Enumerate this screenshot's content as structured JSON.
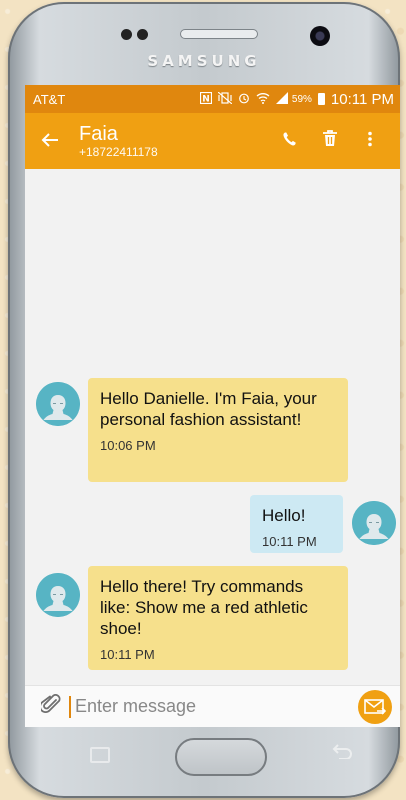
{
  "device": {
    "brand": "SAMSUNG"
  },
  "status_bar": {
    "carrier": "AT&T",
    "battery_percent": "59%",
    "time": "10:11 PM"
  },
  "app_bar": {
    "contact_name": "Faia",
    "contact_number": "+18722411178",
    "icons": [
      "back-arrow-icon",
      "phone-icon",
      "trash-icon",
      "more-vert-icon"
    ]
  },
  "messages": [
    {
      "direction": "incoming",
      "text": "Hello Danielle. I'm Faia, your personal fashion assistant!",
      "time": "10:06 PM"
    },
    {
      "direction": "outgoing",
      "text": "Hello!",
      "time": "10:11 PM"
    },
    {
      "direction": "incoming",
      "text": "Hello there! Try commands like: Show me a red athletic shoe!",
      "time": "10:11 PM"
    }
  ],
  "composer": {
    "placeholder": "Enter message"
  },
  "colors": {
    "status_bar": "#e0870e",
    "app_bar": "#f0a012",
    "incoming_bubble": "#f6e08c",
    "outgoing_bubble": "#cde9f3",
    "avatar": "#57b4c4"
  }
}
